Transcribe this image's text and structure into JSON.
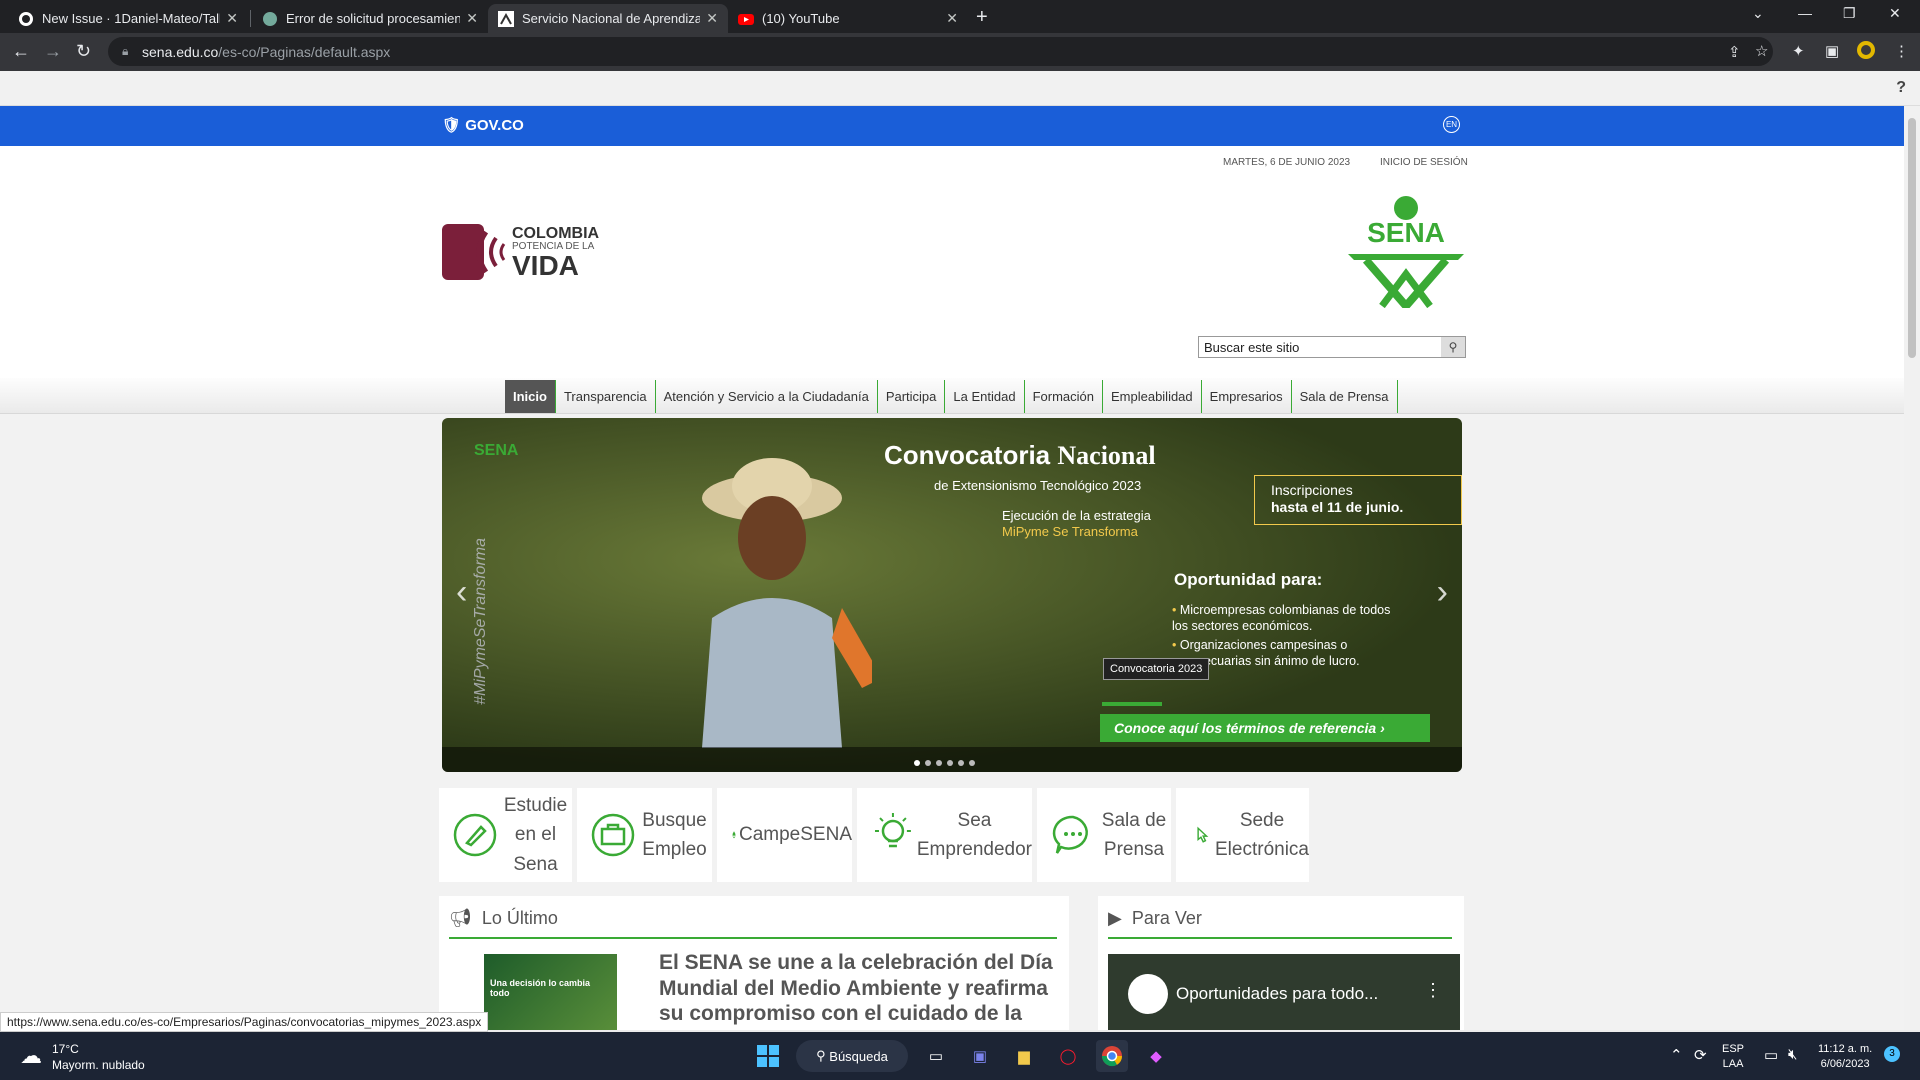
{
  "browser": {
    "tabs": [
      {
        "title": "New Issue · 1Daniel-Mateo/Taller",
        "favicon": "github-icon"
      },
      {
        "title": "Error de solicitud procesamiento",
        "favicon": "chatgpt-icon"
      },
      {
        "title": "Servicio Nacional de Aprendizaje",
        "favicon": "sena-icon",
        "active": true
      },
      {
        "title": "(10) YouTube",
        "favicon": "youtube-icon"
      }
    ],
    "url_host": "sena.edu.co",
    "url_path": "/es-co/Paginas/default.aspx",
    "status_url": "https://www.sena.edu.co/es-co/Empresarios/Paginas/convocatorias_mipymes_2023.aspx"
  },
  "ribbon": {
    "help": "?"
  },
  "gov": {
    "label": "GOV.CO",
    "lang": "EN"
  },
  "header": {
    "date": "MARTES, 6 DE JUNIO 2023",
    "login": "INICIO DE SESIÓN",
    "logo_line1": "COLOMBIA",
    "logo_line2": "POTENCIA DE LA",
    "logo_line3": "VIDA",
    "sena_logo_text": "SENA",
    "search_placeholder": "Buscar este sitio"
  },
  "nav": [
    "Inicio",
    "Transparencia",
    "Atención y Servicio a la Ciudadanía",
    "Participa",
    "La Entidad",
    "Formación",
    "Empleabilidad",
    "Empresarios",
    "Sala de Prensa"
  ],
  "hero": {
    "brand": "SENA",
    "title_a": "Convocatoria",
    "title_b": "Nacional",
    "subtitle": "de Extensionismo Tecnológico 2023",
    "exec_line1": "Ejecución de la estrategia",
    "exec_line2": "MiPyme Se Transforma",
    "insc_line1": "Inscripciones",
    "insc_line2": "hasta el 11 de junio.",
    "oport": "Oportunidad para:",
    "items": [
      "Microempresas colombianas de todos los sectores económicos.",
      "Organizaciones campesinas o agropecuarias sin ánimo de lucro."
    ],
    "tooltip": "Convocatoria 2023",
    "cta": "Conoce aquí los términos de referencia",
    "hashtag": "#MiPymeSeTransforma",
    "dots": 6,
    "active_dot": 0
  },
  "quick_links": [
    {
      "label": "Estudie en el Sena",
      "icon": "pencil-icon",
      "width": 133
    },
    {
      "label": "Busque Empleo",
      "icon": "briefcase-icon",
      "width": 135
    },
    {
      "label": "CampeSENA",
      "icon": "plant-icon",
      "width": 135
    },
    {
      "label": "Sea Emprendedor",
      "icon": "lightbulb-icon",
      "width": 175
    },
    {
      "label": "Sala de Prensa",
      "icon": "chat-icon",
      "width": 134
    },
    {
      "label": "Sede Electrónica",
      "icon": "pointer-icon",
      "width": 133
    }
  ],
  "latest": {
    "heading": "Lo Último",
    "thumb_text": "Una decisión lo cambia todo",
    "news_title": "El SENA se une a la celebración del Día Mundial del Medio Ambiente y reafirma su compromiso con el cuidado de la naturaleza"
  },
  "watch": {
    "heading": "Para Ver",
    "video_title": "Oportunidades para todo..."
  },
  "taskbar": {
    "temp": "17°C",
    "weather": "Mayorm. nublado",
    "search": "Búsqueda",
    "lang1": "ESP",
    "lang2": "LAA",
    "time": "11:12 a. m.",
    "date": "6/06/2023",
    "badge": "3"
  },
  "colors": {
    "gov_blue": "#1a5ed8",
    "sena_green": "#3aaa35",
    "colombia_logo": "#7b1f3a"
  }
}
